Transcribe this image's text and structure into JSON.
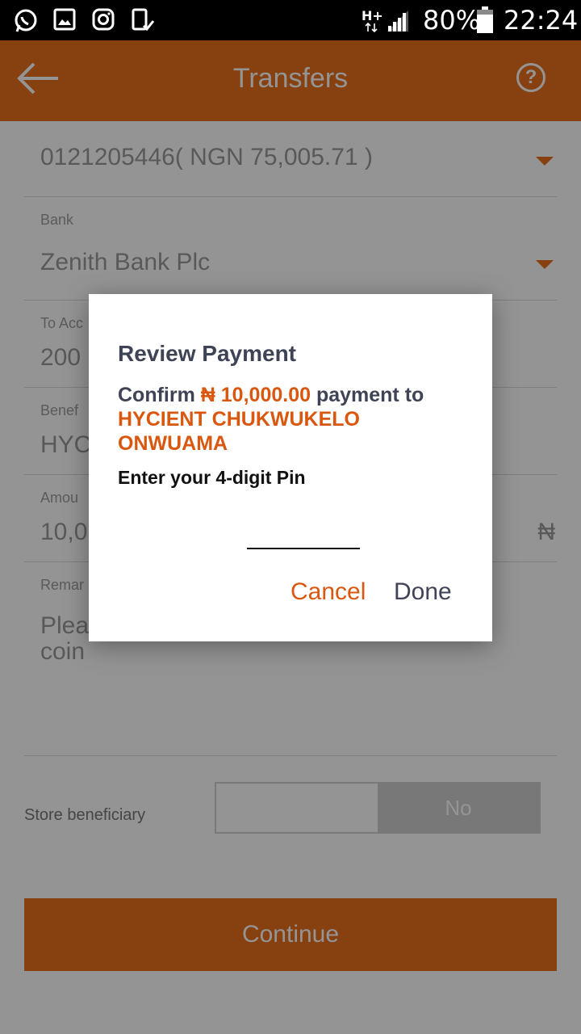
{
  "status_bar": {
    "network": "H+",
    "battery": "80%",
    "time": "22:24"
  },
  "header": {
    "title": "Transfers"
  },
  "form": {
    "account": "0121205446( NGN 75,005.71 )",
    "bank_label": "Bank",
    "bank_value": "Zenith Bank Plc",
    "to_account_label": "To Acc",
    "to_account_value": "200",
    "beneficiary_label": "Benef",
    "beneficiary_value": "HYC",
    "amount_label": "Amou",
    "amount_value": "10,0",
    "amount_currency": "₦",
    "remark_label": "Remar",
    "remark_line1": "Plea",
    "remark_line2": "coin",
    "store_beneficiary_label": "Store beneficiary",
    "store_yes": "",
    "store_no": "No",
    "continue_label": "Continue"
  },
  "dialog": {
    "title": "Review Payment",
    "confirm_prefix": "Confirm ",
    "amount": "₦ 10,000.00",
    "payment_to": " payment to",
    "recipient": "HYCIENT CHUKWUKELO ONWUAMA",
    "pin_label": "Enter your 4-digit Pin",
    "pin_value": "",
    "cancel_label": "Cancel",
    "done_label": "Done"
  },
  "colors": {
    "accent": "#e86f1d",
    "text_dark": "#3f4356",
    "status_bar": "#000000"
  }
}
